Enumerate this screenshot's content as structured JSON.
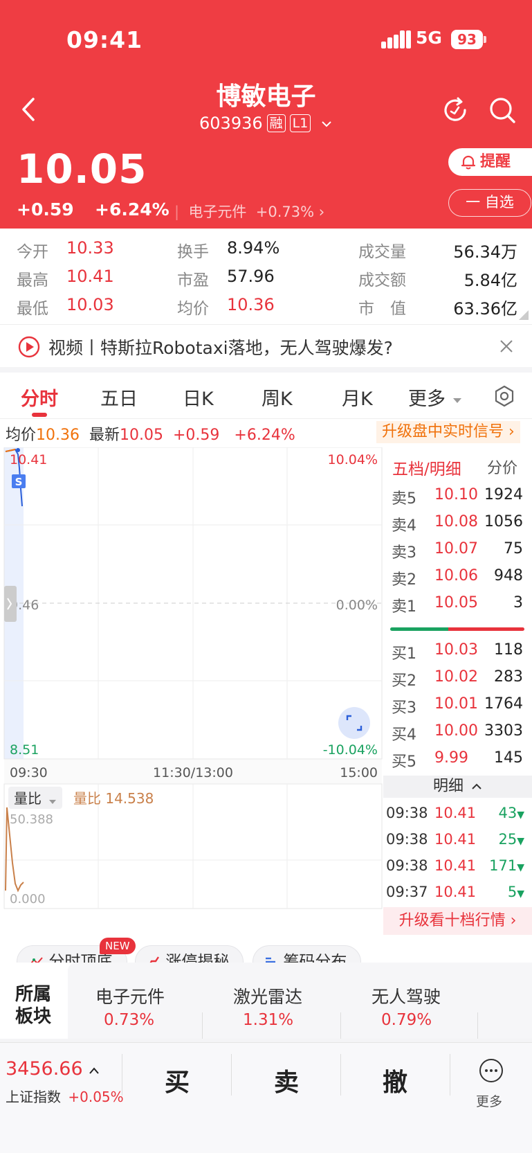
{
  "status": {
    "time": "09:41",
    "network": "5G",
    "battery": "93"
  },
  "stock": {
    "name": "博敏电子",
    "code": "603936",
    "tag_margin": "融",
    "tag_level": "L1",
    "price": "10.05",
    "change": "+0.59",
    "change_pct": "+6.24%",
    "sector": "电子元件",
    "sector_change": "+0.73%"
  },
  "actions": {
    "alert": "提醒",
    "favorite": "一 自选"
  },
  "stats": {
    "open_label": "今开",
    "open": "10.33",
    "high_label": "最高",
    "high": "10.41",
    "low_label": "最低",
    "low": "10.03",
    "turnover_label": "换手",
    "turnover": "8.94%",
    "pe_label": "市盈",
    "pe": "57.96",
    "avg_label": "均价",
    "avg": "10.36",
    "volume_label": "成交量",
    "volume": "56.34万",
    "amount_label": "成交额",
    "amount": "5.84亿",
    "mcap_label": "市　值",
    "mcap": "63.36亿"
  },
  "news": {
    "text": "视频丨特斯拉Robotaxi落地，无人驾驶爆发?"
  },
  "tabs": [
    "分时",
    "五日",
    "日K",
    "周K",
    "月K",
    "更多"
  ],
  "chart_info": {
    "avg_label": "均价",
    "avg": "10.36",
    "latest_label": "最新",
    "latest": "10.05",
    "change": "+0.59",
    "change_pct": "+6.24%",
    "upgrade": "升级盘中实时信号"
  },
  "chart_data": {
    "type": "line",
    "y_top": "10.41",
    "y_mid": "9.46",
    "y_bot": "8.51",
    "pct_top": "10.04%",
    "pct_mid": "0.00%",
    "pct_bot": "-10.04%",
    "x_ticks": [
      "09:30",
      "11:30/13:00",
      "15:00"
    ],
    "marker": "S",
    "volume_ratio_label": "量比",
    "volume_ratio_title": "量比 14.538",
    "vr_top": "50.388",
    "vr_bot": "0.000"
  },
  "order_book": {
    "title": "五档/明细",
    "fen": "分价",
    "asks": [
      {
        "label": "卖5",
        "price": "10.10",
        "vol": "1924"
      },
      {
        "label": "卖4",
        "price": "10.08",
        "vol": "1056"
      },
      {
        "label": "卖3",
        "price": "10.07",
        "vol": "75"
      },
      {
        "label": "卖2",
        "price": "10.06",
        "vol": "948"
      },
      {
        "label": "卖1",
        "price": "10.05",
        "vol": "3"
      }
    ],
    "bids": [
      {
        "label": "买1",
        "price": "10.03",
        "vol": "118"
      },
      {
        "label": "买2",
        "price": "10.02",
        "vol": "283"
      },
      {
        "label": "买3",
        "price": "10.01",
        "vol": "1764"
      },
      {
        "label": "买4",
        "price": "10.00",
        "vol": "3303"
      },
      {
        "label": "买5",
        "price": "9.99",
        "vol": "145"
      }
    ],
    "detail_title": "明细",
    "details": [
      {
        "time": "09:38",
        "price": "10.41",
        "vol": "43"
      },
      {
        "time": "09:38",
        "price": "10.41",
        "vol": "25"
      },
      {
        "time": "09:38",
        "price": "10.41",
        "vol": "171"
      },
      {
        "time": "09:37",
        "price": "10.41",
        "vol": "5"
      }
    ],
    "upgrade_ten": "升级看十档行情"
  },
  "chips": [
    {
      "label": "分时顶底",
      "badge": "NEW"
    },
    {
      "label": "涨停揭秘"
    },
    {
      "label": "筹码分布"
    }
  ],
  "sectors": {
    "label": "所属板块",
    "items": [
      {
        "name": "电子元件",
        "chg": "0.73%"
      },
      {
        "name": "激光雷达",
        "chg": "1.31%"
      },
      {
        "name": "无人驾驶",
        "chg": "0.79%"
      }
    ]
  },
  "bottom": {
    "index_value": "3456.66",
    "index_name": "上证指数",
    "index_change": "+0.05%",
    "buy": "买",
    "sell": "卖",
    "cancel": "撤",
    "more": "更多"
  }
}
